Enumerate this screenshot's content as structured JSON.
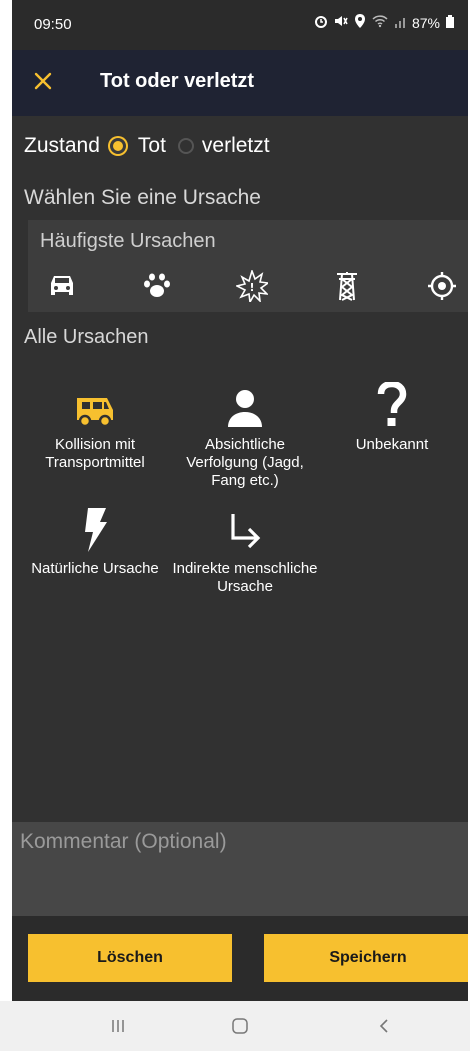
{
  "status_bar": {
    "time": "09:50",
    "battery": "87%"
  },
  "header": {
    "title": "Tot oder verletzt",
    "close_icon": "close-icon",
    "accent_color": "#f7c02f"
  },
  "zustand": {
    "label": "Zustand",
    "options": [
      {
        "label": "Tot",
        "selected": true
      },
      {
        "label": "verletzt",
        "selected": false
      }
    ]
  },
  "cause_prompt": "Wählen Sie eine Ursache",
  "frequent": {
    "title": "Häufigste Ursachen",
    "icons": [
      "car-icon",
      "paw-icon",
      "explosion-icon",
      "power-pylon-icon",
      "target-icon"
    ]
  },
  "all_causes": {
    "title": "Alle Ursachen",
    "items": [
      {
        "label": "Kollision mit Transportmittel",
        "icon": "van-icon",
        "icon_color": "#f7c02f"
      },
      {
        "label": "Absichtliche Verfolgung (Jagd, Fang etc.)",
        "icon": "person-icon"
      },
      {
        "label": "Unbekannt",
        "icon": "question-mark-icon"
      },
      {
        "label": "Natürliche Ursache",
        "icon": "lightning-icon"
      },
      {
        "label": "Indirekte menschliche Ursache",
        "icon": "turn-right-arrow-icon"
      }
    ]
  },
  "comment": {
    "placeholder": "Kommentar (Optional)"
  },
  "buttons": {
    "delete": "Löschen",
    "save": "Speichern"
  },
  "nav": [
    "recent-apps-icon",
    "home-icon",
    "back-icon"
  ]
}
